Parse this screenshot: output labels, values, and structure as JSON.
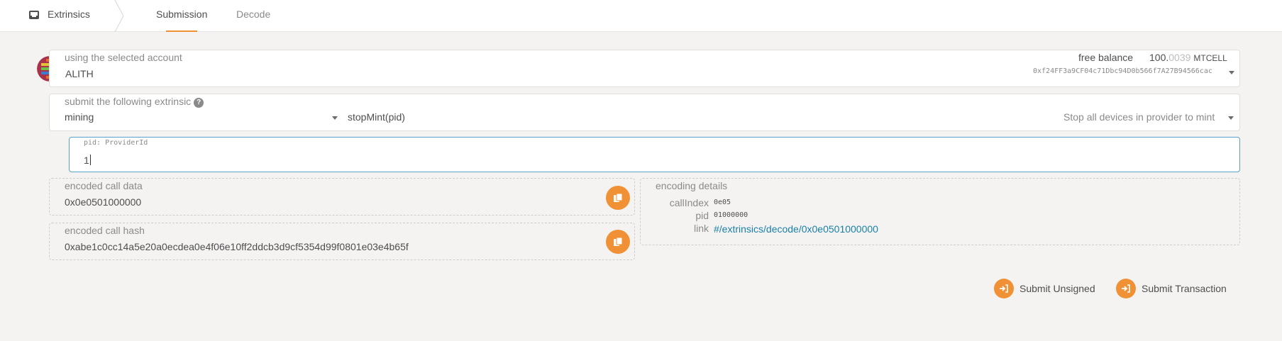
{
  "nav": {
    "section_label": "Extrinsics",
    "tabs": [
      {
        "label": "Submission",
        "active": true
      },
      {
        "label": "Decode",
        "active": false
      }
    ]
  },
  "account": {
    "label": "using the selected account",
    "name": "ALITH",
    "balance_label": "free balance",
    "balance_whole": "100.",
    "balance_fraction": "0039",
    "balance_unit": "MTCELL",
    "address": "0xf24FF3a9CF04c71Dbc94D0b566f7A27B94566cac"
  },
  "extrinsic": {
    "label": "submit the following extrinsic",
    "help_glyph": "?",
    "pallet": "mining",
    "method": "stopMint(pid)",
    "description": "Stop all devices in provider to mint"
  },
  "param": {
    "label": "pid: ProviderId",
    "value": "1"
  },
  "encoded": {
    "call_data_label": "encoded call data",
    "call_data": "0x0e0501000000",
    "call_hash_label": "encoded call hash",
    "call_hash": "0xabe1c0cc14a5e20a0ecdea0e4f06e10ff2ddcb3d9cf5354d99f0801e03e4b65f"
  },
  "details": {
    "label": "encoding details",
    "rows": [
      {
        "key": "callIndex",
        "value": "0e05"
      },
      {
        "key": "pid",
        "value": "01000000"
      },
      {
        "key": "link",
        "value": "#/extrinsics/decode/0x0e0501000000"
      }
    ]
  },
  "actions": {
    "submit_unsigned": "Submit Unsigned",
    "submit_transaction": "Submit Transaction"
  },
  "colors": {
    "accent": "#f19135",
    "link": "#1a7fa8",
    "background": "#f4f3f1"
  }
}
